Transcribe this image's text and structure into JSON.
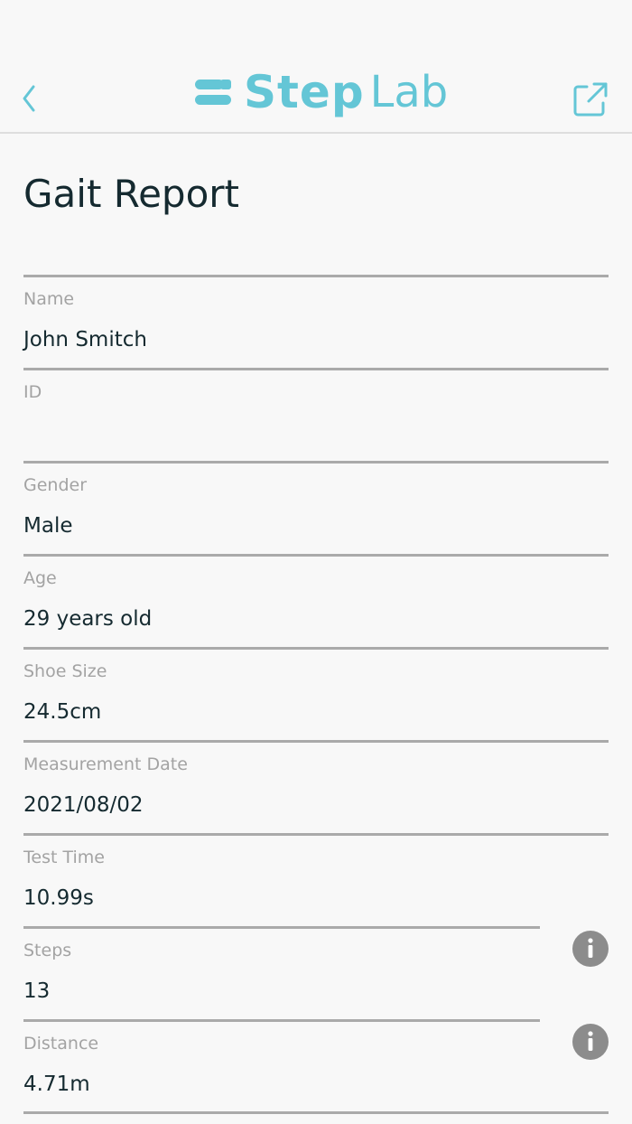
{
  "header": {
    "logo_text_step": "Step",
    "logo_text_lab": "Lab",
    "brand_color": "#64c6d6",
    "back_icon": "chevron-left-icon",
    "share_icon": "share-external-icon"
  },
  "page": {
    "title": "Gait Report"
  },
  "fields": [
    {
      "label": "Name",
      "value": "John Smitch"
    },
    {
      "label": "ID",
      "value": ""
    },
    {
      "label": "Gender",
      "value": "Male"
    },
    {
      "label": "Age",
      "value": "29 years old"
    },
    {
      "label": "Shoe Size",
      "value": "24.5cm"
    },
    {
      "label": "Measurement Date",
      "value": "2021/08/02"
    },
    {
      "label": "Test Time",
      "value": "10.99s"
    },
    {
      "label": "Steps",
      "value": "13",
      "info_icon": "info-icon"
    },
    {
      "label": "Distance",
      "value": "4.71m",
      "info_icon": "info-icon"
    }
  ]
}
